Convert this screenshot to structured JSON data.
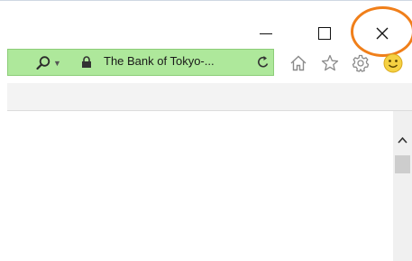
{
  "window": {
    "minimize_glyph": "minimize-icon",
    "maximize_glyph": "maximize-icon",
    "close_glyph": "close-icon",
    "highlight_color": "#f07f1a"
  },
  "address_bar": {
    "site_label": "The Bank of Tokyo-...",
    "background_color": "#aee89b",
    "search_icon": "search-icon",
    "dropdown_icon": "chevron-down-icon",
    "lock_icon": "lock-icon",
    "refresh_icon": "refresh-icon"
  },
  "toolbar": {
    "icons": [
      "home-icon",
      "favorites-star-icon",
      "gear-icon",
      "smiley-feedback-icon"
    ]
  },
  "scrollbar": {
    "up_arrow_icon": "chevron-up-icon"
  }
}
